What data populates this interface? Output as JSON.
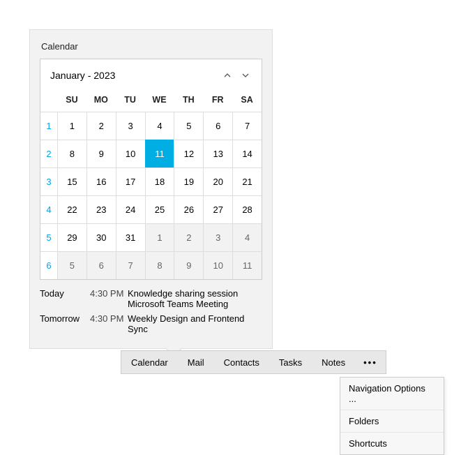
{
  "panel": {
    "title": "Calendar"
  },
  "calendar": {
    "month_label": "January - 2023",
    "dow": [
      "SU",
      "MO",
      "TU",
      "WE",
      "TH",
      "FR",
      "SA"
    ],
    "weeks": [
      "1",
      "2",
      "3",
      "4",
      "5",
      "6"
    ],
    "rows": [
      [
        {
          "n": "1"
        },
        {
          "n": "2"
        },
        {
          "n": "3"
        },
        {
          "n": "4"
        },
        {
          "n": "5"
        },
        {
          "n": "6"
        },
        {
          "n": "7"
        }
      ],
      [
        {
          "n": "8"
        },
        {
          "n": "9"
        },
        {
          "n": "10"
        },
        {
          "n": "11",
          "selected": true
        },
        {
          "n": "12"
        },
        {
          "n": "13"
        },
        {
          "n": "14"
        }
      ],
      [
        {
          "n": "15"
        },
        {
          "n": "16"
        },
        {
          "n": "17"
        },
        {
          "n": "18"
        },
        {
          "n": "19"
        },
        {
          "n": "20"
        },
        {
          "n": "21"
        }
      ],
      [
        {
          "n": "22"
        },
        {
          "n": "23"
        },
        {
          "n": "24"
        },
        {
          "n": "25"
        },
        {
          "n": "26"
        },
        {
          "n": "27"
        },
        {
          "n": "28"
        }
      ],
      [
        {
          "n": "29"
        },
        {
          "n": "30"
        },
        {
          "n": "31"
        },
        {
          "n": "1",
          "trailing": true
        },
        {
          "n": "2",
          "trailing": true
        },
        {
          "n": "3",
          "trailing": true
        },
        {
          "n": "4",
          "trailing": true
        }
      ],
      [
        {
          "n": "5",
          "trailing": true
        },
        {
          "n": "6",
          "trailing": true
        },
        {
          "n": "7",
          "trailing": true
        },
        {
          "n": "8",
          "trailing": true
        },
        {
          "n": "9",
          "trailing": true
        },
        {
          "n": "10",
          "trailing": true
        },
        {
          "n": "11",
          "trailing": true
        }
      ]
    ]
  },
  "events": [
    {
      "day": "Today",
      "time": "4:30 PM",
      "title": "Knowledge sharing session",
      "subtitle": "Microsoft Teams Meeting"
    },
    {
      "day": "Tomorrow",
      "time": "4:30 PM",
      "title": "Weekly Design and Frontend Sync",
      "subtitle": ""
    }
  ],
  "navbar": [
    "Calendar",
    "Mail",
    "Contacts",
    "Tasks",
    "Notes"
  ],
  "navbar_more": "•••",
  "popup": [
    "Navigation Options ...",
    "Folders",
    "Shortcuts"
  ]
}
